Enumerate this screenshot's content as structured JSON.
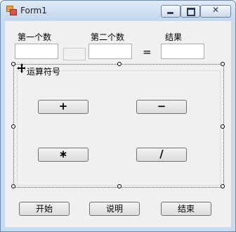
{
  "window": {
    "title": "Form1"
  },
  "labels": {
    "num1": "第一个数",
    "num2": "第二个数",
    "result": "结果",
    "equals": "="
  },
  "inputs": {
    "num1": "",
    "num2": "",
    "result": ""
  },
  "group": {
    "title": "运算符号",
    "operators": {
      "add": "+",
      "subtract": "−",
      "multiply": "∗",
      "divide": "/"
    }
  },
  "buttons": {
    "start": "开始",
    "help": "说明",
    "end": "结束"
  }
}
